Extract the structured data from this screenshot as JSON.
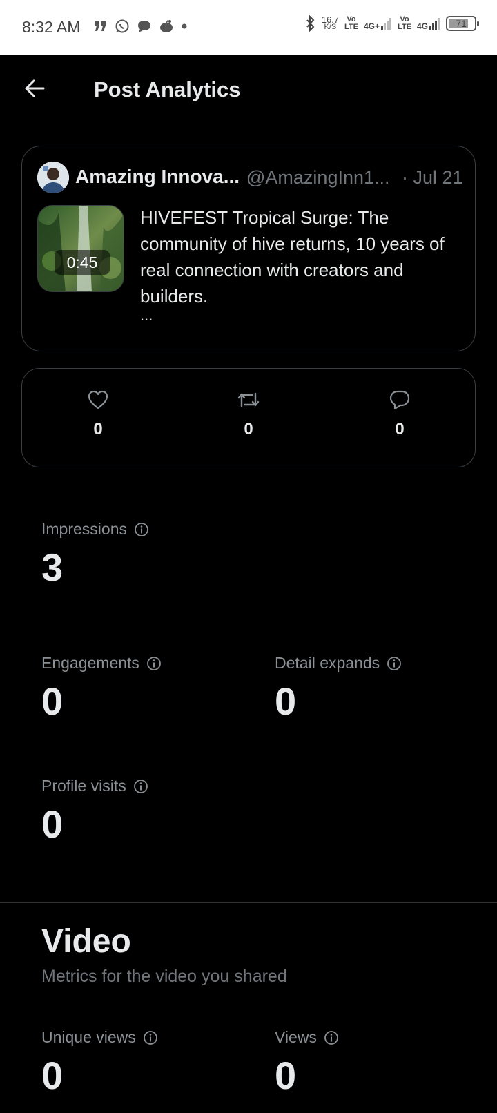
{
  "status_bar": {
    "time": "8:32 AM",
    "net_speed": "16.7",
    "net_unit": "K/S",
    "vo1": "Vo",
    "lte1": "LTE",
    "net1": "4G+",
    "vo2": "Vo",
    "lte2": "LTE",
    "net2": "4G",
    "battery": "71"
  },
  "header": {
    "title": "Post Analytics"
  },
  "post": {
    "author_name": "Amazing Innova...",
    "author_handle": "@AmazingInn1...",
    "date": "· Jul 21",
    "video_duration": "0:45",
    "text": "HIVEFEST Tropical Surge: The community of hive returns, 10 years of real connection with creators and builders.",
    "more": "..."
  },
  "engagement": {
    "likes": "0",
    "reposts": "0",
    "replies": "0"
  },
  "metrics": {
    "impressions": {
      "label": "Impressions",
      "value": "3"
    },
    "engagements": {
      "label": "Engagements",
      "value": "0"
    },
    "detail_expands": {
      "label": "Detail expands",
      "value": "0"
    },
    "profile_visits": {
      "label": "Profile visits",
      "value": "0"
    }
  },
  "video_section": {
    "title": "Video",
    "subtitle": "Metrics for the video you shared",
    "unique_views": {
      "label": "Unique views",
      "value": "0"
    },
    "views": {
      "label": "Views",
      "value": "0"
    }
  },
  "colors": {
    "background": "#000000",
    "text_primary": "#e7e9ea",
    "text_secondary": "#71767b",
    "border": "#3a3f44"
  }
}
